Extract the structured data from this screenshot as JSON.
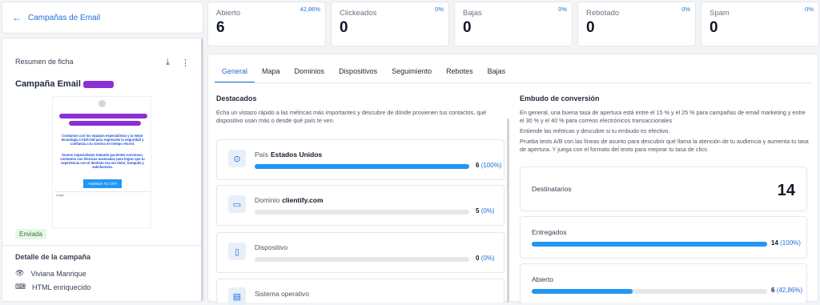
{
  "nav": {
    "back_label": "Campañas de Email"
  },
  "sheet": {
    "heading": "Resumen de ficha",
    "title": "Campaña Email",
    "preview_body": "Contamos con los equipos especialistas y la mejor tecnología CAD/CAM para regresarte la seguridad y confianza a tu sonrisa en tiempo récord.",
    "preview_body2": "Somos especialistas tratando pacientes nerviosos, contamos con técnicas avanzadas para lograr que tu experiencia con el dentista sea sin dolor, tranquila y satisfactoria.",
    "preview_button": "AGENDA TU CITA",
    "preview_image_label": "Image",
    "status": "Enviada",
    "detail_title": "Detalle de la campaña",
    "owner": "Viviana Manrique",
    "format": "HTML enriquecido"
  },
  "stats": [
    {
      "label": "Abierto",
      "value": "6",
      "pct": "42,86%"
    },
    {
      "label": "Clickeados",
      "value": "0",
      "pct": "0%"
    },
    {
      "label": "Bajas",
      "value": "0",
      "pct": "0%"
    },
    {
      "label": "Rebotado",
      "value": "0",
      "pct": "0%"
    },
    {
      "label": "Spam",
      "value": "0",
      "pct": "0%"
    }
  ],
  "tabs": [
    "General",
    "Mapa",
    "Dominios",
    "Dispositivos",
    "Seguimiento",
    "Rebotes",
    "Bajas"
  ],
  "highlights": {
    "title": "Destacados",
    "description": "Echa un vistazo rápido a las métricas más importantes y descubre de dónde provienen tus contactos, qué dispositivo usan más o desde qué país te ven.",
    "items": [
      {
        "label": "País",
        "value": "Estados Unidos",
        "count": "6",
        "pct": "(100%)",
        "fill": 1.0
      },
      {
        "label": "Dominio",
        "value": "clientify.com",
        "count": "5",
        "pct": "(0%)",
        "fill": 0
      },
      {
        "label": "Dispositivo",
        "value": "",
        "count": "0",
        "pct": "(0%)",
        "fill": 0
      },
      {
        "label": "Sistema operativo",
        "value": "",
        "count": "",
        "pct": "",
        "fill": 0
      }
    ]
  },
  "funnel": {
    "title": "Embudo de conversión",
    "p1": "En general, una buena tasa de apertura está entre el 15 % y el 25 % para campañas de email marketing y entre el 30 % y el 40 % para correos electrónicos transaccionales",
    "p2": "Entiende las métricas y descubre si tu embudo es efectivo.",
    "p3": "Prueba tests A/B con las líneas de asunto para descubrir qué llama la atención de tu audiencia y aumenta tu tasa de apertura. Y juega con el formato del texto para mejorar tu tasa de clics.",
    "recipients_label": "Destinatarios",
    "recipients_value": "14",
    "delivered_label": "Entregados",
    "delivered_count": "14",
    "delivered_pct": "(100%)",
    "delivered_fill": 1.0,
    "opened_label": "Abierto",
    "opened_count": "6",
    "opened_pct": "(42,86%)",
    "opened_fill": 0.4286
  }
}
